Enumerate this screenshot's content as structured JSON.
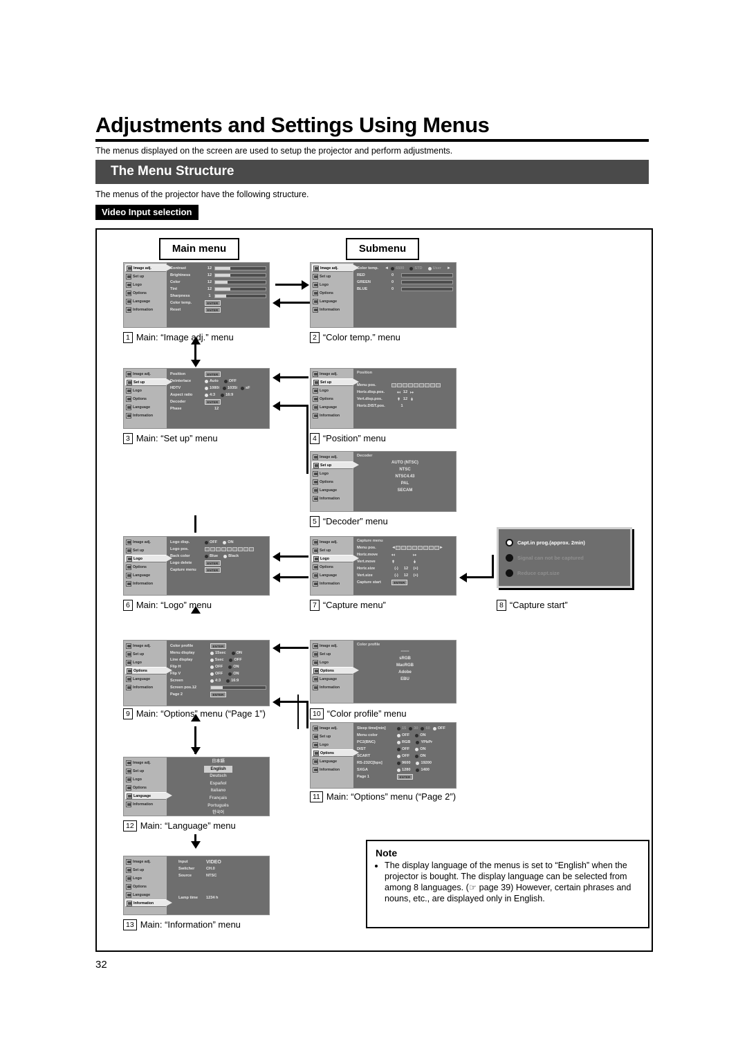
{
  "header": {
    "doc_title": "Adjustments and Settings Using Menus",
    "intro": "The menus displayed on the screen are used to setup the projector and perform adjustments.",
    "section_title": "The Menu Structure",
    "sub_intro": "The menus of the projector have the following structure.",
    "video_tag": "Video Input selection"
  },
  "columns": {
    "main": "Main menu",
    "sub": "Submenu"
  },
  "sidebar_items": [
    "Image adj.",
    "Set up",
    "Logo",
    "Options",
    "Language",
    "Information"
  ],
  "enter_label": "ENTER",
  "panels": {
    "image_adj": {
      "selected": "Image adj.",
      "rows": [
        {
          "label": "Contrast",
          "value": "12",
          "bar": 30
        },
        {
          "label": "Brightness",
          "value": "12",
          "bar": 30
        },
        {
          "label": "Color",
          "value": "12",
          "bar": 25
        },
        {
          "label": "Tint",
          "value": "12",
          "bar": 30
        },
        {
          "label": "Sharpness",
          "value": "1",
          "bar": 22
        },
        {
          "label": "Color temp.",
          "value": "ENTER"
        },
        {
          "label": "Reset",
          "value": "ENTER"
        }
      ]
    },
    "color_temp": {
      "selected": "Image adj.",
      "title": "Color temp.",
      "options": [
        "6500",
        "STD",
        "User"
      ],
      "rows": [
        {
          "label": "RED",
          "value": "0",
          "bar": 50
        },
        {
          "label": "GREEN",
          "value": "0",
          "bar": 50
        },
        {
          "label": "BLUE",
          "value": "0",
          "bar": 50
        }
      ]
    },
    "set_up": {
      "selected": "Set up",
      "rows": [
        {
          "label": "Position",
          "value": "ENTER"
        },
        {
          "label": "Deinterlace",
          "options": [
            "Auto",
            "OFF"
          ],
          "on": 0
        },
        {
          "label": "HDTV",
          "options": [
            "1080i",
            "1035i",
            "sF"
          ],
          "on": 0
        },
        {
          "label": "Aspect ratio",
          "options": [
            "4:3",
            "16:9"
          ],
          "on": 0
        },
        {
          "label": "Decoder",
          "value": "ENTER"
        },
        {
          "label": "Phase",
          "value": "12"
        }
      ]
    },
    "position": {
      "selected": "Set up",
      "title": "Position",
      "rows": [
        {
          "label": "Menu pos.",
          "type": "posbar"
        },
        {
          "label": "Horiz.disp.pos.",
          "value": "12"
        },
        {
          "label": "Vert.disp.pos.",
          "value": "12"
        },
        {
          "label": "Horiz.DIST.pos.",
          "value": "1"
        }
      ]
    },
    "decoder": {
      "selected": "Set up",
      "title": "Decoder",
      "items": [
        "AUTO     (NTSC)",
        "NTSC",
        "NTSC4.43",
        "PAL",
        "SECAM"
      ]
    },
    "logo": {
      "selected": "Logo",
      "rows": [
        {
          "label": "Logo disp.",
          "options": [
            "OFF",
            "ON"
          ],
          "on": 1
        },
        {
          "label": "Logo pos.",
          "type": "posbar"
        },
        {
          "label": "Back color",
          "options": [
            "Blue",
            "Black"
          ],
          "on": 1
        },
        {
          "label": "Logo delete",
          "value": "ENTER"
        },
        {
          "label": "Capture menu",
          "value": "ENTER"
        }
      ]
    },
    "capture": {
      "selected": "Logo",
      "title": "Capture menu",
      "rows": [
        {
          "label": "Menu pos.",
          "type": "posbar"
        },
        {
          "label": "Horiz.move",
          "type": "move"
        },
        {
          "label": "Vert.move",
          "type": "move"
        },
        {
          "label": "Horiz.size",
          "minus": "(-)",
          "value": "12",
          "plus": "(+)"
        },
        {
          "label": "Vert.size",
          "minus": "(-)",
          "value": "12",
          "plus": "(+)"
        },
        {
          "label": "Capture start",
          "value": "ENTER"
        }
      ]
    },
    "capture_start": {
      "items": [
        {
          "text": "Capt.in prog.(approx. 2min)",
          "active": true
        },
        {
          "text": "Signal can not be captured",
          "active": false
        },
        {
          "text": "Reduce capt.size",
          "active": false
        }
      ]
    },
    "options1": {
      "selected": "Options",
      "rows": [
        {
          "label": "Color profile",
          "value": "ENTER"
        },
        {
          "label": "Menu display",
          "options": [
            "15sec",
            "ON"
          ],
          "on": 0
        },
        {
          "label": "Line display",
          "options": [
            "5sec",
            "OFF"
          ],
          "on": 0
        },
        {
          "label": "Flip H",
          "options": [
            "OFF",
            "ON"
          ],
          "on": 0
        },
        {
          "label": "Flip V",
          "options": [
            "OFF",
            "ON"
          ],
          "on": 0
        },
        {
          "label": "Screen",
          "options": [
            "4:3",
            "16:9"
          ],
          "on": 0
        },
        {
          "label": "Screen pos.12",
          "bar": 22
        },
        {
          "label": "Page 2",
          "value": "ENTER"
        }
      ]
    },
    "color_profile": {
      "selected": "Options",
      "title": "Color profile",
      "items": [
        "------",
        "sRGB",
        "MacRGB",
        "Adobe",
        "EBU"
      ]
    },
    "options2": {
      "selected": "Options",
      "header_label": "Sleep time[min]",
      "header_options": [
        "15",
        "30",
        "60",
        "OFF"
      ],
      "header_on": 3,
      "rows": [
        {
          "label": "Menu color",
          "options": [
            "OFF",
            "ON"
          ],
          "on": 0
        },
        {
          "label": "PC2(BNC)",
          "options": [
            "RGB",
            "YPbPr"
          ],
          "on": 0
        },
        {
          "label": "DIST",
          "options": [
            "OFF",
            "ON"
          ],
          "on": 1
        },
        {
          "label": "SCART",
          "options": [
            "OFF",
            "ON"
          ],
          "on": 0
        },
        {
          "label": "RS-232C[bps]",
          "options": [
            "9600",
            "19200"
          ],
          "on": 1
        },
        {
          "label": "SXGA",
          "options": [
            "1280",
            "1400"
          ],
          "on": 0
        },
        {
          "label": "Page 1",
          "value": "ENTER"
        }
      ]
    },
    "language": {
      "selected": "Language",
      "items": [
        "日本語",
        "English",
        "Deutsch",
        "Español",
        "Italiano",
        "Français",
        "Português",
        "한국어"
      ],
      "selected_item": "English"
    },
    "information": {
      "selected": "Information",
      "rows": [
        {
          "label": "Input",
          "value": "VIDEO"
        },
        {
          "label": "Switcher",
          "value": "CH.0"
        },
        {
          "label": "Source",
          "value": "NTSC"
        }
      ],
      "lamp_label": "Lamp time",
      "lamp_value": "1234 h"
    }
  },
  "captions": [
    {
      "n": "1",
      "text": "Main: “Image adj.” menu"
    },
    {
      "n": "2",
      "text": "“Color temp.” menu"
    },
    {
      "n": "3",
      "text": "Main: “Set up” menu"
    },
    {
      "n": "4",
      "text": "“Position” menu"
    },
    {
      "n": "5",
      "text": "“Decoder” menu"
    },
    {
      "n": "6",
      "text": "Main: “Logo” menu"
    },
    {
      "n": "7",
      "text": "“Capture menu”"
    },
    {
      "n": "8",
      "text": "“Capture start”"
    },
    {
      "n": "9",
      "text": "Main: “Options” menu (“Page 1”)"
    },
    {
      "n": "10",
      "text": "“Color profile” menu"
    },
    {
      "n": "11",
      "text": "Main: “Options” menu (“Page 2”)"
    },
    {
      "n": "12",
      "text": "Main: “Language” menu"
    },
    {
      "n": "13",
      "text": "Main: “Information” menu"
    }
  ],
  "note": {
    "title": "Note",
    "body": "The display language of the menus is set to “English” when the projector is bought. The display language can be selected from among 8 languages. (☞ page 39) However, certain phrases and nouns, etc., are displayed only in English."
  },
  "page_number": "32"
}
